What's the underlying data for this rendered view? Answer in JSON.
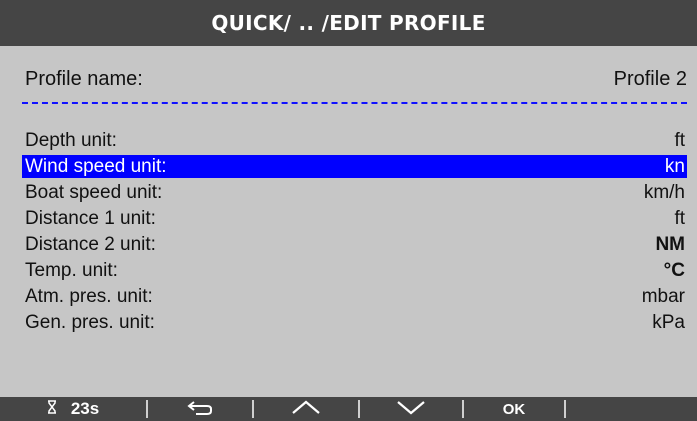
{
  "header": {
    "breadcrumb": "QUICK/ .. /EDIT PROFILE"
  },
  "profile": {
    "label": "Profile name:",
    "value": "Profile 2"
  },
  "units": [
    {
      "label": "Depth unit:",
      "value": "ft"
    },
    {
      "label": "Wind speed unit:",
      "value": "kn"
    },
    {
      "label": "Boat speed unit:",
      "value": "km/h"
    },
    {
      "label": "Distance 1 unit:",
      "value": "ft"
    },
    {
      "label": "Distance 2 unit:",
      "value": "NM"
    },
    {
      "label": "Temp. unit:",
      "value": "°C"
    },
    {
      "label": "Atm. pres. unit:",
      "value": "mbar"
    },
    {
      "label": "Gen. pres. unit:",
      "value": "kPa"
    }
  ],
  "footer": {
    "timer": "23s",
    "ok_label": "OK",
    "icons": [
      "hourglass-icon",
      "back-arrow-icon",
      "chevron-up-icon",
      "chevron-down-icon"
    ]
  },
  "colors": {
    "title_bg": "#454545",
    "screen_bg": "#c6c6c6",
    "selection": "#0000ff",
    "divider": "#1010ff"
  }
}
